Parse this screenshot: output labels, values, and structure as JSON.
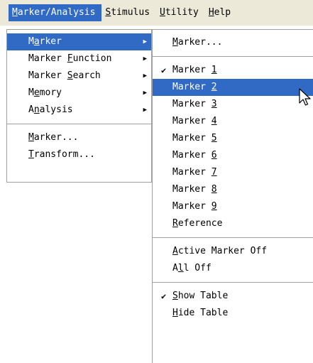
{
  "menubar": {
    "items": [
      {
        "pre": "",
        "key": "M",
        "post": "arker/Analysis"
      },
      {
        "pre": "",
        "key": "S",
        "post": "timulus"
      },
      {
        "pre": "",
        "key": "U",
        "post": "tility"
      },
      {
        "pre": "",
        "key": "H",
        "post": "elp"
      }
    ]
  },
  "main_menu": {
    "items": [
      {
        "pre": "M",
        "key": "a",
        "post": "rker"
      },
      {
        "pre": "Marker ",
        "key": "F",
        "post": "unction"
      },
      {
        "pre": "Marker ",
        "key": "S",
        "post": "earch"
      },
      {
        "pre": "M",
        "key": "e",
        "post": "mory"
      },
      {
        "pre": "A",
        "key": "n",
        "post": "alysis"
      },
      {
        "pre": "",
        "key": "M",
        "post": "arker..."
      },
      {
        "pre": "",
        "key": "T",
        "post": "ransform..."
      }
    ],
    "submenu_arrow": "▶"
  },
  "sub_menu": {
    "items": [
      {
        "pre": "",
        "key": "M",
        "post": "arker..."
      },
      {
        "pre": "Marker ",
        "key": "1",
        "post": ""
      },
      {
        "pre": "Marker ",
        "key": "2",
        "post": ""
      },
      {
        "pre": "Marker ",
        "key": "3",
        "post": ""
      },
      {
        "pre": "Marker ",
        "key": "4",
        "post": ""
      },
      {
        "pre": "Marker ",
        "key": "5",
        "post": ""
      },
      {
        "pre": "Marker ",
        "key": "6",
        "post": ""
      },
      {
        "pre": "Marker ",
        "key": "7",
        "post": ""
      },
      {
        "pre": "Marker ",
        "key": "8",
        "post": ""
      },
      {
        "pre": "Marker ",
        "key": "9",
        "post": ""
      },
      {
        "pre": "",
        "key": "R",
        "post": "eference"
      },
      {
        "pre": "",
        "key": "A",
        "post": "ctive Marker Off"
      },
      {
        "pre": "A",
        "key": "l",
        "post": "l Off"
      },
      {
        "pre": "",
        "key": "S",
        "post": "how Table"
      },
      {
        "pre": "",
        "key": "H",
        "post": "ide Table"
      }
    ],
    "check_mark": "✔"
  },
  "colors": {
    "menubar_bg": "#ece9d8",
    "highlight": "#316ac5",
    "menu_bg": "#ffffff",
    "border": "#a0a0a0"
  }
}
